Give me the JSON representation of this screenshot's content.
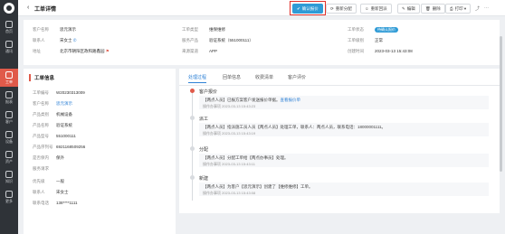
{
  "rail": {
    "items": [
      {
        "label": "首页"
      },
      {
        "label": "通讯"
      },
      {
        "label": "报表"
      },
      {
        "label": "工单"
      },
      {
        "label": "客户"
      },
      {
        "label": "设备"
      },
      {
        "label": "资产"
      },
      {
        "label": "知识"
      },
      {
        "label": "更多"
      }
    ]
  },
  "topbar": {
    "back": "‹",
    "title": "工单详情",
    "buttons": {
      "confirm": "确认报价",
      "reassign": "重新分配",
      "rework": "重新回派",
      "edit": "编辑",
      "delete": "删除",
      "print": "打印"
    }
  },
  "info": {
    "customer_name_label": "客户名称",
    "customer_name": "思元演示",
    "contact_label": "联系人",
    "contact": "宋女士",
    "address_label": "地址",
    "address": "北京市朝阳区政和路鑫园",
    "order_type_label": "工单类型",
    "order_type": "维保维修",
    "service_product_label": "服务产品",
    "service_product": "验证系统（551000111）",
    "source_label": "来源渠道",
    "source": "APP",
    "status_label": "工单状态",
    "status": "待确认报价",
    "level_label": "工单级别",
    "level": "正常",
    "created_label": "创建时间",
    "created": "2023-03-13 15:43:08"
  },
  "detail": {
    "section_title": "工单信息",
    "rows": [
      {
        "k": "工单编号",
        "v": "W20230313009"
      },
      {
        "k": "客户名称",
        "v": "思元演示"
      },
      {
        "k": "产品类别",
        "v": "机械设备"
      },
      {
        "k": "产品名称",
        "v": "验证系统"
      },
      {
        "k": "产品型号",
        "v": "551000111"
      },
      {
        "k": "产品序列号",
        "v": "6921168509256"
      },
      {
        "k": "是否保内",
        "v": "保外"
      },
      {
        "k": "服务请求",
        "v": ""
      },
      {
        "k": "优先级",
        "v": "一般"
      },
      {
        "k": "联系人",
        "v": "宋女士"
      },
      {
        "k": "联系电话",
        "v": "138****1111"
      }
    ]
  },
  "tabs": [
    "处理过程",
    "回单信息",
    "收费清单",
    "客户评价"
  ],
  "timeline": [
    {
      "title": "客户报价",
      "desc": "【两点人员】已报方案客户发送报价单据。",
      "link": "查看报价单",
      "time": "操作办事项  2023-03-13 15:43:23"
    },
    {
      "title": "派工",
      "desc": "【两点人员】指派施工员人员【两点人员】处理工单，联系人：两点人员，联系电话：18000001111。",
      "link": "",
      "time": "操作办事项  2023-03-13 15:43:19"
    },
    {
      "title": "分配",
      "desc": "【两点人员】分配工单给【两点办事员】处理。",
      "link": "",
      "time": "操作办事项  2023-03-13 15:43:11"
    },
    {
      "title": "新建",
      "desc": "【两点人员】为客户【思元演示】创建了【维修维修】工单。",
      "link": "",
      "time": "操作办事项  2023-03-13 15:43:08"
    }
  ]
}
